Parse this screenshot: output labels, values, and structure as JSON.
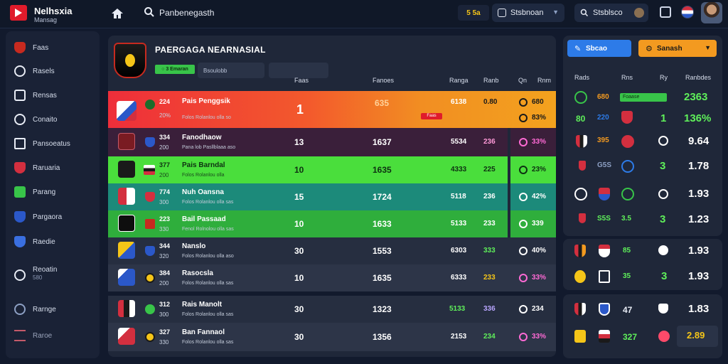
{
  "topbar": {
    "brand_title": "Nelhsxia",
    "brand_sub": "Mansag",
    "search_text": "Panbenegasth",
    "coins": "5 5a",
    "account_label": "Stsbnoan",
    "user_label": "Stsblsco"
  },
  "sidebar": {
    "items": [
      {
        "label": "Faas",
        "sub": ""
      },
      {
        "label": "Rasels",
        "sub": ""
      },
      {
        "label": "Rensas",
        "sub": ""
      },
      {
        "label": "Conaito",
        "sub": ""
      },
      {
        "label": "Pansoeatus",
        "sub": ""
      },
      {
        "label": "Raruaria",
        "sub": ""
      },
      {
        "label": "Parang",
        "sub": ""
      },
      {
        "label": "Pargaora",
        "sub": ""
      },
      {
        "label": "Raedie",
        "sub": ""
      },
      {
        "label": "Reoatin",
        "sub": "580"
      },
      {
        "label": "Rarnge",
        "sub": ""
      },
      {
        "label": "Raroe",
        "sub": ""
      }
    ]
  },
  "main": {
    "title": "PAERGAGA NEARNASIAL",
    "live_badge": "○ 3 Emaran",
    "filter_text": "Bsoulobb",
    "columns": [
      "Faas",
      "Fanoes",
      "Ranga",
      "Ranb",
      "Qn",
      "Rnm"
    ],
    "rows": [
      {
        "rank": "224",
        "rank2": "20%",
        "team": "Pais Penggsik",
        "sub": "Folos Rolanlou olla so",
        "mp": "1",
        "pts": "635",
        "gd": "6138",
        "form": "0.80",
        "pct": "680",
        "pct2": "83%",
        "tag": "Faas"
      },
      {
        "rank": "334",
        "rank2": "200",
        "team": "Fanodhaow",
        "sub": "Pana lob Pasllblaaa aso",
        "mp": "13",
        "pts": "1637",
        "gd": "5534",
        "form": "236",
        "pct2": "33%"
      },
      {
        "rank": "377",
        "rank2": "200",
        "team": "Pais Barndal",
        "sub": "Folos Rolanlou olla",
        "mp": "10",
        "pts": "1635",
        "gd": "4333",
        "form": "225",
        "pct2": "23%"
      },
      {
        "rank": "774",
        "rank2": "300",
        "team": "Nuh Oansna",
        "sub": "Folos Rolanlou olla sas",
        "mp": "15",
        "pts": "1724",
        "gd": "5118",
        "form": "236",
        "pct2": "42%"
      },
      {
        "rank": "223",
        "rank2": "330",
        "team": "Bail Passaad",
        "sub": "Fenol Rolnolou olla sas",
        "mp": "10",
        "pts": "1633",
        "gd": "5133",
        "form": "233",
        "pct2": "339"
      },
      {
        "rank": "344",
        "rank2": "320",
        "team": "Nanslo",
        "sub": "Folos Rolanlou olla aso",
        "mp": "30",
        "pts": "1553",
        "gd": "6303",
        "form": "333",
        "pct2": "40%"
      },
      {
        "rank": "384",
        "rank2": "200",
        "team": "Rasocsla",
        "sub": "Folos Rolanlou olla sas",
        "mp": "10",
        "pts": "1635",
        "gd": "6333",
        "form": "233",
        "pct2": "33%"
      },
      {
        "rank": "312",
        "rank2": "300",
        "team": "Rais Manolt",
        "sub": "Folos Rolanlou olla sas",
        "mp": "30",
        "pts": "1323",
        "gd": "5133",
        "form": "336",
        "pct2": "234"
      },
      {
        "rank": "327",
        "rank2": "330",
        "team": "Ban Fannaol",
        "sub": "Folos Rolanlou olla sas",
        "mp": "30",
        "pts": "1356",
        "gd": "2153",
        "form": "234",
        "pct2": "33%"
      }
    ]
  },
  "right": {
    "btn_left": "Sbcao",
    "btn_right": "Sanash",
    "headers": [
      "Rads",
      "Rns",
      "Ry",
      "Ranbdes"
    ],
    "odds_badge": "Foaase",
    "rows": [
      {
        "a": "680",
        "c": "2363"
      },
      {
        "a": "80",
        "b": "220",
        "c": "1",
        "d": "136%"
      },
      {
        "a": "395",
        "c": "9.64"
      },
      {
        "a": "G5S",
        "c": "3",
        "d": "1.78"
      },
      {
        "a": "",
        "c": "",
        "d": "1.93"
      },
      {
        "a": "S5S",
        "b": "3.5",
        "c": "3",
        "d": "1.23"
      }
    ],
    "panel2": [
      {
        "a": "85",
        "d": "1.93"
      },
      {
        "a": "35",
        "b": "3",
        "d": "1.93"
      }
    ],
    "panel3": [
      {
        "a": "47",
        "d": "1.83"
      },
      {
        "a": "327",
        "d": "2.89"
      }
    ]
  }
}
